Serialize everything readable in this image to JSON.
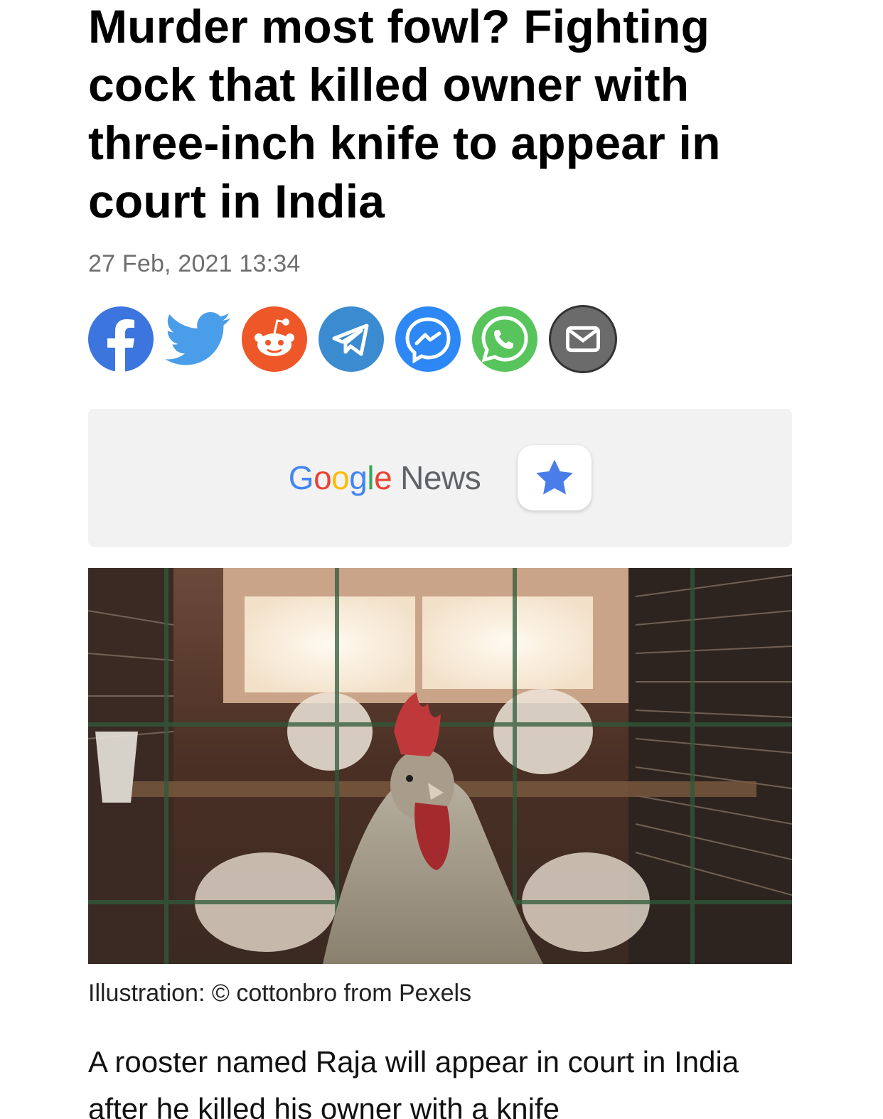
{
  "article": {
    "headline": "Murder most fowl? Fighting cock that killed owner with three-inch knife to appear in court in India",
    "date": "27 Feb, 2021 13:34"
  },
  "share": {
    "buttons": [
      {
        "name": "facebook",
        "icon": "facebook-icon",
        "color": "#3b75dd"
      },
      {
        "name": "twitter",
        "icon": "twitter-icon",
        "color": "#4a9de9"
      },
      {
        "name": "reddit",
        "icon": "reddit-icon",
        "color": "#ee5728"
      },
      {
        "name": "telegram",
        "icon": "telegram-icon",
        "color": "#3b8bd0"
      },
      {
        "name": "messenger",
        "icon": "messenger-icon",
        "color": "#2d87f5"
      },
      {
        "name": "whatsapp",
        "icon": "whatsapp-icon",
        "color": "#57c55c"
      },
      {
        "name": "email",
        "icon": "email-icon",
        "color": "#6b6b6b"
      }
    ]
  },
  "google_news": {
    "logo_letters": [
      "G",
      "o",
      "o",
      "g",
      "l",
      "e"
    ],
    "news_label": "News",
    "star_icon": "star-icon",
    "star_color": "#4a7de8"
  },
  "photo": {
    "alt": "rooster in cage",
    "caption": "Illustration: © cottonbro from Pexels"
  },
  "body": {
    "lead": "A rooster named Raja will appear in court in India after he killed his owner with a knife"
  }
}
